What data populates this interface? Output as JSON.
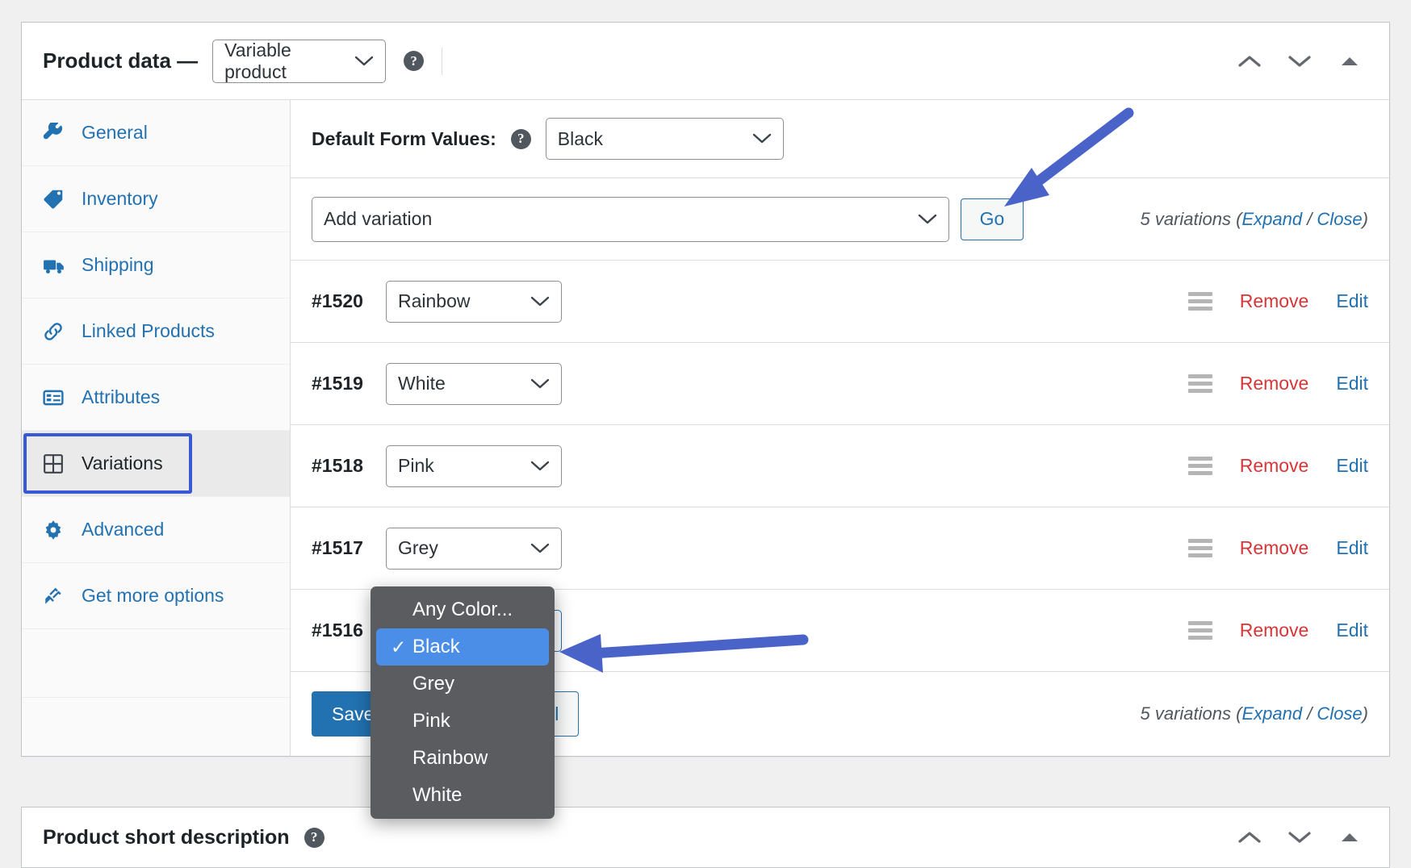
{
  "colors": {
    "link": "#2271b1",
    "danger": "#d63638",
    "focus_ring": "#3858d6",
    "menu_bg": "#5b5c60",
    "menu_highlight": "#4b8ee8",
    "annotation_arrow": "#4a63c8"
  },
  "product_data_panel": {
    "title": "Product data —",
    "product_type": {
      "value": "Variable product",
      "icon": "chevron-down-icon"
    },
    "help_icon": "?",
    "header_controls": [
      {
        "name": "move-up",
        "icon": "chevron-up-icon"
      },
      {
        "name": "move-down",
        "icon": "chevron-down-icon"
      },
      {
        "name": "toggle-panel",
        "icon": "triangle-up-icon"
      }
    ]
  },
  "tabs": [
    {
      "label": "General",
      "icon": "wrench-icon",
      "active": false
    },
    {
      "label": "Inventory",
      "icon": "tag-icon",
      "active": false
    },
    {
      "label": "Shipping",
      "icon": "truck-icon",
      "active": false
    },
    {
      "label": "Linked Products",
      "icon": "link-icon",
      "active": false
    },
    {
      "label": "Attributes",
      "icon": "list-icon",
      "active": false
    },
    {
      "label": "Variations",
      "icon": "grid-icon",
      "active": true
    },
    {
      "label": "Advanced",
      "icon": "gear-icon",
      "active": false
    },
    {
      "label": "Get more options",
      "icon": "plug-icon",
      "active": false
    }
  ],
  "variations_panel": {
    "default_form_values": {
      "label": "Default Form Values:",
      "help_icon": "?",
      "selected": "Black"
    },
    "toolbar": {
      "add_variation_select": "Add variation",
      "go_label": "Go",
      "count_text": "5 variations ",
      "count_open": "(",
      "expand_label": "Expand",
      "separator": " / ",
      "close_label": "Close",
      "count_end": ")"
    },
    "rows": [
      {
        "id": "#1520",
        "color": "Rainbow",
        "remove": "Remove",
        "edit": "Edit"
      },
      {
        "id": "#1519",
        "color": "White",
        "remove": "Remove",
        "edit": "Edit"
      },
      {
        "id": "#1518",
        "color": "Pink",
        "remove": "Remove",
        "edit": "Edit"
      },
      {
        "id": "#1517",
        "color": "Grey",
        "remove": "Remove",
        "edit": "Edit"
      },
      {
        "id": "#1516",
        "color": "Black",
        "remove": "Remove",
        "edit": "Edit"
      }
    ],
    "footer": {
      "save_label": "Save changes",
      "cancel_label": "Cancel",
      "count_text": "5 variations ",
      "count_open": "(",
      "expand_label": "Expand",
      "separator": " / ",
      "close_label": "Close",
      "count_end": ")"
    }
  },
  "open_dropdown": {
    "options": [
      {
        "label": "Any Color...",
        "selected": false
      },
      {
        "label": "Black",
        "selected": true
      },
      {
        "label": "Grey",
        "selected": false
      },
      {
        "label": "Pink",
        "selected": false
      },
      {
        "label": "Rainbow",
        "selected": false
      },
      {
        "label": "White",
        "selected": false
      }
    ],
    "check_glyph": "✓"
  },
  "short_description_panel": {
    "title": "Product short description",
    "help_icon": "?",
    "header_controls": [
      {
        "name": "move-up",
        "icon": "chevron-up-icon"
      },
      {
        "name": "move-down",
        "icon": "chevron-down-icon"
      },
      {
        "name": "toggle-panel",
        "icon": "triangle-up-icon"
      }
    ]
  }
}
